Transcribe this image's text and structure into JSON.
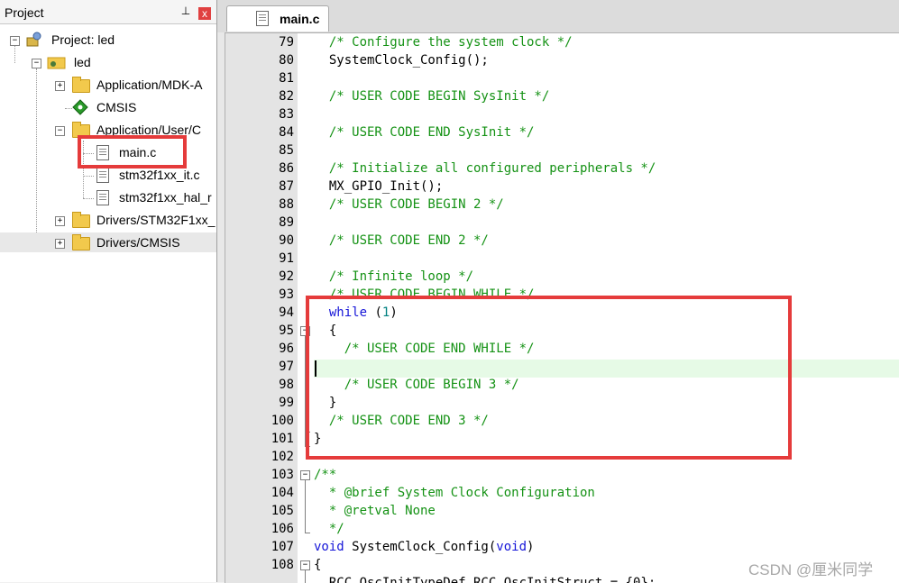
{
  "project_panel": {
    "title": "Project",
    "pin_glyph": " 1",
    "close_glyph": "x",
    "tree": [
      {
        "label": "Project: led",
        "icon": "project-icon"
      },
      {
        "label": "led",
        "icon": "target-folder-icon"
      },
      {
        "label": "Application/MDK-A",
        "icon": "folder-icon"
      },
      {
        "label": "CMSIS",
        "icon": "cmsis-gem-icon"
      },
      {
        "label": "Application/User/C",
        "icon": "folder-icon"
      },
      {
        "label": "main.c",
        "icon": "file-icon"
      },
      {
        "label": "stm32f1xx_it.c",
        "icon": "file-icon"
      },
      {
        "label": "stm32f1xx_hal_r",
        "icon": "file-icon"
      },
      {
        "label": "Drivers/STM32F1xx_",
        "icon": "folder-icon"
      },
      {
        "label": "Drivers/CMSIS",
        "icon": "folder-icon"
      }
    ]
  },
  "editor": {
    "tab_label": "main.c",
    "lines": [
      {
        "n": "79",
        "text": "  /* Configure the system clock */"
      },
      {
        "n": "80",
        "text": "  SystemClock_Config();"
      },
      {
        "n": "81",
        "text": ""
      },
      {
        "n": "82",
        "text": "  /* USER CODE BEGIN SysInit */"
      },
      {
        "n": "83",
        "text": ""
      },
      {
        "n": "84",
        "text": "  /* USER CODE END SysInit */"
      },
      {
        "n": "85",
        "text": ""
      },
      {
        "n": "86",
        "text": "  /* Initialize all configured peripherals */"
      },
      {
        "n": "87",
        "text": "  MX_GPIO_Init();"
      },
      {
        "n": "88",
        "text": "  /* USER CODE BEGIN 2 */"
      },
      {
        "n": "89",
        "text": ""
      },
      {
        "n": "90",
        "text": "  /* USER CODE END 2 */"
      },
      {
        "n": "91",
        "text": ""
      },
      {
        "n": "92",
        "text": "  /* Infinite loop */"
      },
      {
        "n": "93",
        "text": "  /* USER CODE BEGIN WHILE */"
      },
      {
        "n": "94",
        "text": "  while (1)"
      },
      {
        "n": "95",
        "text": "  {"
      },
      {
        "n": "96",
        "text": "    /* USER CODE END WHILE */"
      },
      {
        "n": "97",
        "text": ""
      },
      {
        "n": "98",
        "text": "    /* USER CODE BEGIN 3 */"
      },
      {
        "n": "99",
        "text": "  }"
      },
      {
        "n": "100",
        "text": "  /* USER CODE END 3 */"
      },
      {
        "n": "101",
        "text": "}"
      },
      {
        "n": "102",
        "text": ""
      },
      {
        "n": "103",
        "text": "/**"
      },
      {
        "n": "104",
        "text": "  * @brief System Clock Configuration"
      },
      {
        "n": "105",
        "text": "  * @retval None"
      },
      {
        "n": "106",
        "text": "  */"
      },
      {
        "n": "107",
        "text": "void SystemClock_Config(void)"
      },
      {
        "n": "108",
        "text": "{"
      }
    ],
    "partial_line": "  RCC_OscInitTypeDef RCC_OscInitStruct = {0};"
  },
  "colors": {
    "comment": "#159215",
    "keyword": "#1515d8",
    "number": "#008080",
    "highlight_box": "#e53b3b",
    "current_line": "#e6fae6"
  },
  "watermark": "CSDN @厘米同学"
}
